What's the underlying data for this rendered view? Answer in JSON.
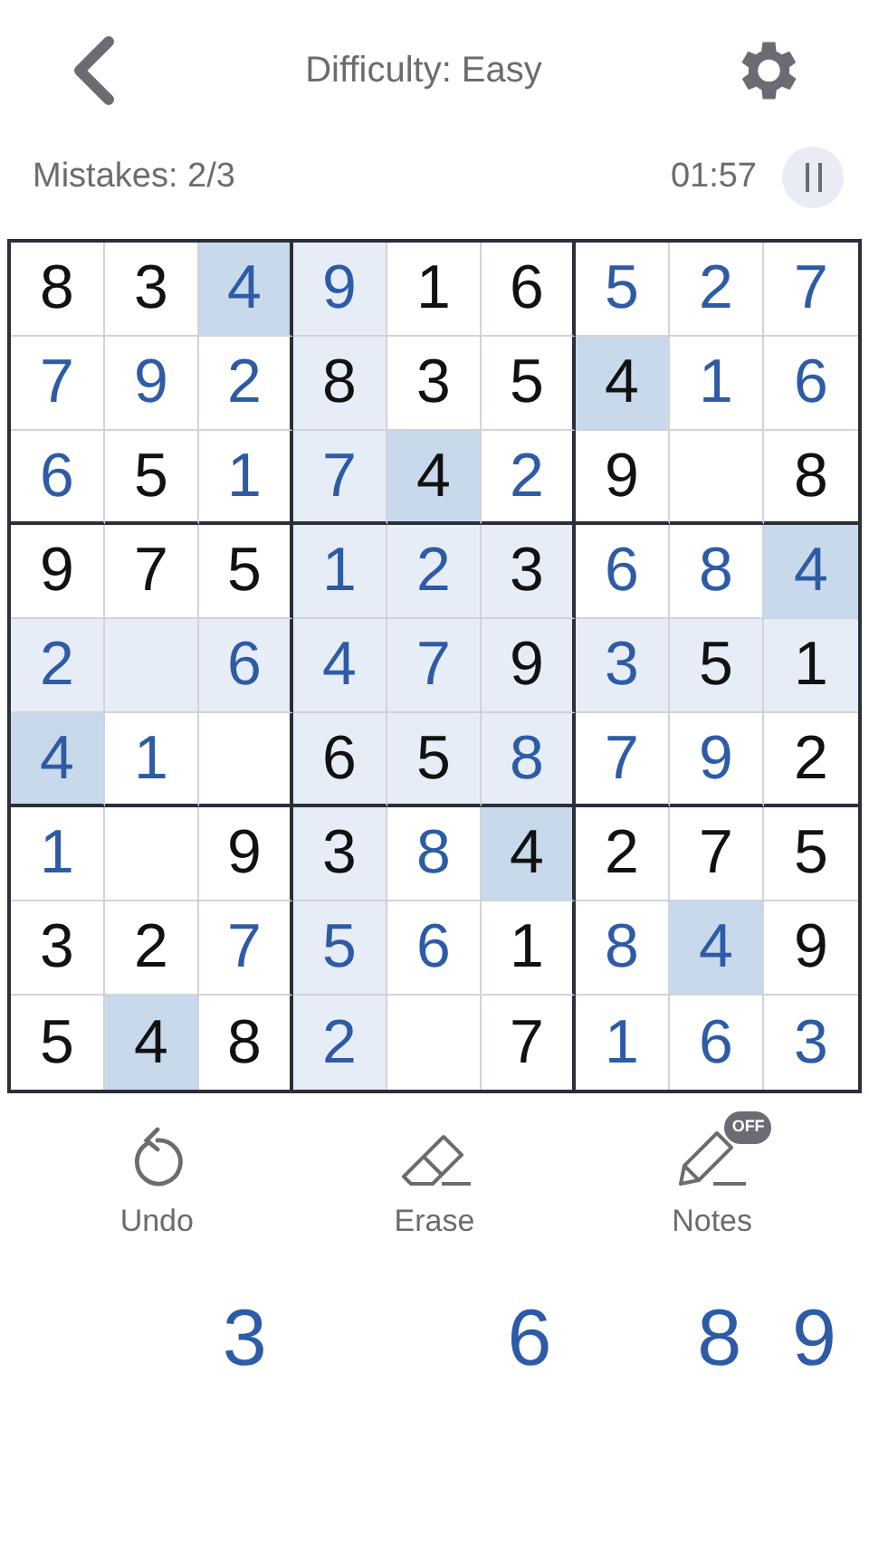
{
  "header": {
    "title": "Difficulty: Easy"
  },
  "status": {
    "mistakes": "Mistakes: 2/3",
    "timer": "01:57"
  },
  "grid": [
    [
      {
        "v": "8",
        "given": true,
        "related": false,
        "same": false
      },
      {
        "v": "3",
        "given": true,
        "related": false,
        "same": false
      },
      {
        "v": "4",
        "given": false,
        "same": true
      },
      {
        "v": "9",
        "given": false,
        "related": true,
        "same": false
      },
      {
        "v": "1",
        "given": true,
        "related": false,
        "same": false
      },
      {
        "v": "6",
        "given": true,
        "related": false,
        "same": false
      },
      {
        "v": "5",
        "given": false,
        "related": false,
        "same": false
      },
      {
        "v": "2",
        "given": false,
        "related": false,
        "same": false
      },
      {
        "v": "7",
        "given": false,
        "related": false,
        "same": false
      }
    ],
    [
      {
        "v": "7",
        "given": false,
        "related": false,
        "same": false
      },
      {
        "v": "9",
        "given": false,
        "related": false,
        "same": false
      },
      {
        "v": "2",
        "given": false,
        "related": false,
        "same": false
      },
      {
        "v": "8",
        "given": true,
        "related": true,
        "same": false
      },
      {
        "v": "3",
        "given": true,
        "related": false,
        "same": false
      },
      {
        "v": "5",
        "given": true,
        "related": false,
        "same": false
      },
      {
        "v": "4",
        "given": true,
        "same": true
      },
      {
        "v": "1",
        "given": false,
        "related": false,
        "same": false
      },
      {
        "v": "6",
        "given": false,
        "related": false,
        "same": false
      }
    ],
    [
      {
        "v": "6",
        "given": false,
        "related": false,
        "same": false
      },
      {
        "v": "5",
        "given": true,
        "related": false,
        "same": false
      },
      {
        "v": "1",
        "given": false,
        "related": false,
        "same": false
      },
      {
        "v": "7",
        "given": false,
        "related": true,
        "same": false
      },
      {
        "v": "4",
        "given": true,
        "same": true
      },
      {
        "v": "2",
        "given": false,
        "related": false,
        "same": false
      },
      {
        "v": "9",
        "given": true,
        "related": false,
        "same": false
      },
      {
        "related": false,
        "same": false
      },
      {
        "v": "8",
        "given": true,
        "related": false,
        "same": false
      }
    ],
    [
      {
        "v": "9",
        "given": true,
        "related": false,
        "same": false
      },
      {
        "v": "7",
        "given": true,
        "related": false,
        "same": false
      },
      {
        "v": "5",
        "given": true,
        "related": false,
        "same": false
      },
      {
        "v": "1",
        "given": false,
        "related": true,
        "same": false
      },
      {
        "v": "2",
        "given": false,
        "related": true,
        "same": false
      },
      {
        "v": "3",
        "given": true,
        "related": true,
        "same": false
      },
      {
        "v": "6",
        "given": false,
        "related": false,
        "same": false
      },
      {
        "v": "8",
        "given": false,
        "related": false,
        "same": false
      },
      {
        "v": "4",
        "given": false,
        "same": true
      }
    ],
    [
      {
        "v": "2",
        "given": false,
        "related": true,
        "same": false
      },
      {
        "related": true,
        "same": false
      },
      {
        "v": "6",
        "given": false,
        "related": true,
        "same": false
      },
      {
        "v": "4",
        "given": false,
        "related": true,
        "same": false
      },
      {
        "v": "7",
        "given": false,
        "related": true,
        "same": false
      },
      {
        "v": "9",
        "given": true,
        "related": true,
        "same": false
      },
      {
        "v": "3",
        "given": false,
        "related": true,
        "same": false
      },
      {
        "v": "5",
        "given": true,
        "related": true,
        "same": false
      },
      {
        "v": "1",
        "given": true,
        "related": true,
        "same": false
      }
    ],
    [
      {
        "v": "4",
        "given": false,
        "same": true
      },
      {
        "v": "1",
        "given": false,
        "related": false,
        "same": false
      },
      {
        "related": false,
        "same": false
      },
      {
        "v": "6",
        "given": true,
        "related": true,
        "same": false
      },
      {
        "v": "5",
        "given": true,
        "related": true,
        "same": false
      },
      {
        "v": "8",
        "given": false,
        "related": true,
        "same": false
      },
      {
        "v": "7",
        "given": false,
        "related": false,
        "same": false
      },
      {
        "v": "9",
        "given": false,
        "related": false,
        "same": false
      },
      {
        "v": "2",
        "given": true,
        "related": false,
        "same": false
      }
    ],
    [
      {
        "v": "1",
        "given": false,
        "related": false,
        "same": false
      },
      {
        "related": false,
        "same": false
      },
      {
        "v": "9",
        "given": true,
        "related": false,
        "same": false
      },
      {
        "v": "3",
        "given": true,
        "related": true,
        "same": false
      },
      {
        "v": "8",
        "given": false,
        "related": false,
        "same": false
      },
      {
        "v": "4",
        "given": true,
        "same": true
      },
      {
        "v": "2",
        "given": true,
        "related": false,
        "same": false
      },
      {
        "v": "7",
        "given": true,
        "related": false,
        "same": false
      },
      {
        "v": "5",
        "given": true,
        "related": false,
        "same": false
      }
    ],
    [
      {
        "v": "3",
        "given": true,
        "related": false,
        "same": false
      },
      {
        "v": "2",
        "given": true,
        "related": false,
        "same": false
      },
      {
        "v": "7",
        "given": false,
        "related": false,
        "same": false
      },
      {
        "v": "5",
        "given": false,
        "related": true,
        "same": false
      },
      {
        "v": "6",
        "given": false,
        "related": false,
        "same": false
      },
      {
        "v": "1",
        "given": true,
        "related": false,
        "same": false
      },
      {
        "v": "8",
        "given": false,
        "related": false,
        "same": false
      },
      {
        "v": "4",
        "given": false,
        "same": true
      },
      {
        "v": "9",
        "given": true,
        "related": false,
        "same": false
      }
    ],
    [
      {
        "v": "5",
        "given": true,
        "related": false,
        "same": false
      },
      {
        "v": "4",
        "given": true,
        "same": true
      },
      {
        "v": "8",
        "given": true,
        "related": false,
        "same": false
      },
      {
        "v": "2",
        "given": false,
        "related": true,
        "same": false
      },
      {
        "related": false,
        "same": false
      },
      {
        "v": "7",
        "given": true,
        "related": false,
        "same": false
      },
      {
        "v": "1",
        "given": false,
        "related": false,
        "same": false
      },
      {
        "v": "6",
        "given": false,
        "related": false,
        "same": false
      },
      {
        "v": "3",
        "given": false,
        "related": false,
        "same": false
      }
    ]
  ],
  "tools": [
    {
      "kind": "undo",
      "label": "Undo"
    },
    {
      "kind": "erase",
      "label": "Erase"
    },
    {
      "kind": "notes",
      "label": "Notes",
      "badge": "OFF"
    }
  ],
  "number_pad": [
    {
      "kind": "empty"
    },
    {
      "kind": "empty"
    },
    {
      "kind": "digit",
      "label": "3"
    },
    {
      "kind": "empty"
    },
    {
      "kind": "empty"
    },
    {
      "kind": "digit",
      "label": "6"
    },
    {
      "kind": "empty"
    },
    {
      "kind": "digit",
      "label": "8"
    },
    {
      "kind": "digit",
      "label": "9"
    }
  ]
}
